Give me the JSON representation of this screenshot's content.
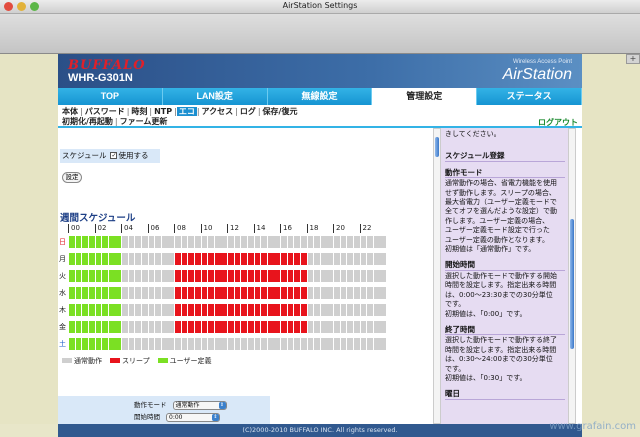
{
  "window": {
    "title": "AirStation Settings"
  },
  "header": {
    "brand": "BUFFALO",
    "model": "WHR-G301N",
    "product_sub": "Wireless Access Point",
    "product": "AirStation"
  },
  "tabs": [
    {
      "label": "TOP"
    },
    {
      "label": "LAN設定"
    },
    {
      "label": "無線設定"
    },
    {
      "label": "管理設定",
      "active": true
    },
    {
      "label": "ステータス"
    }
  ],
  "subnav": {
    "row1": [
      "本体",
      "パスワード",
      "時刻",
      "NTP",
      "エコ",
      "アクセス",
      "ログ",
      "保存/復元"
    ],
    "row1_active": "エコ",
    "row2": [
      "初期化/再起動",
      "ファーム更新"
    ],
    "logout": "ログアウト"
  },
  "schedule": {
    "label": "スケジュール",
    "enable_label": "使用する",
    "enabled": true,
    "set_button": "設定",
    "weekly_title": "週間スケジュール",
    "hours": [
      "00",
      "02",
      "04",
      "06",
      "08",
      "10",
      "12",
      "14",
      "16",
      "18",
      "20",
      "22"
    ],
    "days": [
      {
        "label": "日",
        "color": "#e0202a",
        "mode": [
          "user",
          "user",
          "user",
          "user",
          "user",
          "user",
          "user",
          "user",
          "normal",
          "normal",
          "normal",
          "normal",
          "normal",
          "normal",
          "normal",
          "normal",
          "normal",
          "normal",
          "normal",
          "normal",
          "normal",
          "normal",
          "normal",
          "normal",
          "normal",
          "normal",
          "normal",
          "normal",
          "normal",
          "normal",
          "normal",
          "normal",
          "normal",
          "normal",
          "normal",
          "normal",
          "normal",
          "normal",
          "normal",
          "normal",
          "normal",
          "normal",
          "normal",
          "normal",
          "normal",
          "normal",
          "normal",
          "normal"
        ]
      },
      {
        "label": "月",
        "color": "#222222",
        "mode": [
          "user",
          "user",
          "user",
          "user",
          "user",
          "user",
          "user",
          "user",
          "normal",
          "normal",
          "normal",
          "normal",
          "normal",
          "normal",
          "normal",
          "normal",
          "sleep",
          "sleep",
          "sleep",
          "sleep",
          "sleep",
          "sleep",
          "sleep",
          "sleep",
          "sleep",
          "sleep",
          "sleep",
          "sleep",
          "sleep",
          "sleep",
          "sleep",
          "sleep",
          "sleep",
          "sleep",
          "sleep",
          "sleep",
          "normal",
          "normal",
          "normal",
          "normal",
          "normal",
          "normal",
          "normal",
          "normal",
          "normal",
          "normal",
          "normal",
          "normal"
        ]
      },
      {
        "label": "火",
        "color": "#222222",
        "mode": [
          "user",
          "user",
          "user",
          "user",
          "user",
          "user",
          "user",
          "user",
          "normal",
          "normal",
          "normal",
          "normal",
          "normal",
          "normal",
          "normal",
          "normal",
          "sleep",
          "sleep",
          "sleep",
          "sleep",
          "sleep",
          "sleep",
          "sleep",
          "sleep",
          "sleep",
          "sleep",
          "sleep",
          "sleep",
          "sleep",
          "sleep",
          "sleep",
          "sleep",
          "sleep",
          "sleep",
          "sleep",
          "sleep",
          "normal",
          "normal",
          "normal",
          "normal",
          "normal",
          "normal",
          "normal",
          "normal",
          "normal",
          "normal",
          "normal",
          "normal"
        ]
      },
      {
        "label": "水",
        "color": "#222222",
        "mode": [
          "user",
          "user",
          "user",
          "user",
          "user",
          "user",
          "user",
          "user",
          "normal",
          "normal",
          "normal",
          "normal",
          "normal",
          "normal",
          "normal",
          "normal",
          "sleep",
          "sleep",
          "sleep",
          "sleep",
          "sleep",
          "sleep",
          "sleep",
          "sleep",
          "sleep",
          "sleep",
          "sleep",
          "sleep",
          "sleep",
          "sleep",
          "sleep",
          "sleep",
          "sleep",
          "sleep",
          "sleep",
          "sleep",
          "normal",
          "normal",
          "normal",
          "normal",
          "normal",
          "normal",
          "normal",
          "normal",
          "normal",
          "normal",
          "normal",
          "normal"
        ]
      },
      {
        "label": "木",
        "color": "#222222",
        "mode": [
          "user",
          "user",
          "user",
          "user",
          "user",
          "user",
          "user",
          "user",
          "normal",
          "normal",
          "normal",
          "normal",
          "normal",
          "normal",
          "normal",
          "normal",
          "sleep",
          "sleep",
          "sleep",
          "sleep",
          "sleep",
          "sleep",
          "sleep",
          "sleep",
          "sleep",
          "sleep",
          "sleep",
          "sleep",
          "sleep",
          "sleep",
          "sleep",
          "sleep",
          "sleep",
          "sleep",
          "sleep",
          "sleep",
          "normal",
          "normal",
          "normal",
          "normal",
          "normal",
          "normal",
          "normal",
          "normal",
          "normal",
          "normal",
          "normal",
          "normal"
        ]
      },
      {
        "label": "金",
        "color": "#222222",
        "mode": [
          "user",
          "user",
          "user",
          "user",
          "user",
          "user",
          "user",
          "user",
          "normal",
          "normal",
          "normal",
          "normal",
          "normal",
          "normal",
          "normal",
          "normal",
          "sleep",
          "sleep",
          "sleep",
          "sleep",
          "sleep",
          "sleep",
          "sleep",
          "sleep",
          "sleep",
          "sleep",
          "sleep",
          "sleep",
          "sleep",
          "sleep",
          "sleep",
          "sleep",
          "sleep",
          "sleep",
          "sleep",
          "sleep",
          "normal",
          "normal",
          "normal",
          "normal",
          "normal",
          "normal",
          "normal",
          "normal",
          "normal",
          "normal",
          "normal",
          "normal"
        ]
      },
      {
        "label": "土",
        "color": "#1d5fc9",
        "mode": [
          "user",
          "user",
          "user",
          "user",
          "user",
          "user",
          "user",
          "user",
          "normal",
          "normal",
          "normal",
          "normal",
          "normal",
          "normal",
          "normal",
          "normal",
          "normal",
          "normal",
          "normal",
          "normal",
          "normal",
          "normal",
          "normal",
          "normal",
          "normal",
          "normal",
          "normal",
          "normal",
          "normal",
          "normal",
          "normal",
          "normal",
          "normal",
          "normal",
          "normal",
          "normal",
          "normal",
          "normal",
          "normal",
          "normal",
          "normal",
          "normal",
          "normal",
          "normal",
          "normal",
          "normal",
          "normal",
          "normal"
        ]
      }
    ],
    "colors": {
      "normal": "#cfcfcf",
      "sleep": "#e8141c",
      "user": "#7be023"
    },
    "legend": [
      {
        "key": "normal",
        "label": "通常動作"
      },
      {
        "key": "sleep",
        "label": "スリープ"
      },
      {
        "key": "user",
        "label": "ユーザー定義"
      }
    ]
  },
  "form": {
    "mode_label": "動作モード",
    "mode_value": "通常動作",
    "start_label": "開始時間",
    "start_value": "0:00"
  },
  "help": {
    "intro": "きしてください。",
    "title": "スケジュール登録",
    "sections": [
      {
        "heading": "動作モード",
        "lines": [
          "通常動作の場合、省電力機能を使用",
          "せず動作します。スリープの場合、",
          "最大省電力（ユーザー定義モードで",
          "全てオフを選んだような設定）で動",
          "作します。ユーザー定義の場合、",
          "ユーザー定義モード設定で行った",
          "ユーザー定義の動作となります。",
          "初期値は「通常動作」です。"
        ]
      },
      {
        "heading": "開始時間",
        "lines": [
          "選択した動作モードで動作する開始",
          "時間を設定します。指定出来る時間",
          "は、0:00〜23:30までの30分単位",
          "です。",
          "初期値は、「0:00」です。"
        ]
      },
      {
        "heading": "終了時間",
        "lines": [
          "選択した動作モードで動作する終了",
          "時間を設定します。指定出来る時間",
          "は、0:30〜24:00までの30分単位",
          "です。",
          "初期値は、「0:30」です。"
        ]
      },
      {
        "heading": "曜日",
        "lines": []
      }
    ]
  },
  "footer": {
    "copyright": "(C)2000-2010 BUFFALO INC. All rights reserved."
  },
  "watermark": "www.grafain.com"
}
